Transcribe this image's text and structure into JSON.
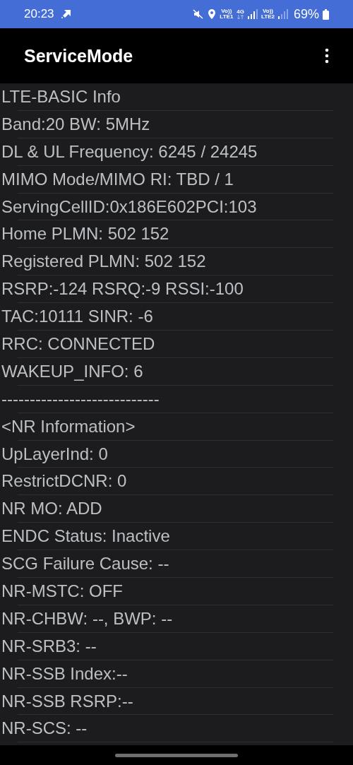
{
  "status_bar": {
    "time": "20:23",
    "sim1_label": "Vo))",
    "sim1_network": "LTE1",
    "network_type": "4G",
    "sim2_label": "Vo))",
    "sim2_network": "LTE2",
    "battery": "69%"
  },
  "app_bar": {
    "title": "ServiceMode"
  },
  "lines": [
    "LTE-BASIC Info",
    "Band:20 BW: 5MHz",
    "DL & UL Frequency: 6245 / 24245",
    "MIMO Mode/MIMO RI: TBD / 1",
    "ServingCellID:0x186E602PCI:103",
    "Home PLMN: 502 152",
    "Registered PLMN: 502 152",
    "RSRP:-124 RSRQ:-9 RSSI:-100",
    "TAC:10111 SINR: -6",
    "RRC: CONNECTED",
    "WAKEUP_INFO: 6",
    "----------------------------",
    "<NR Information>",
    "UpLayerInd: 0",
    "RestrictDCNR: 0",
    "NR MO: ADD",
    "ENDC Status: Inactive",
    "SCG Failure Cause: --",
    "NR-MSTC: OFF",
    "NR-CHBW: --, BWP: --",
    "NR-SRB3: --",
    "NR-SSB Index:--",
    "NR-SSB RSRP:--",
    "NR-SCS: --"
  ]
}
